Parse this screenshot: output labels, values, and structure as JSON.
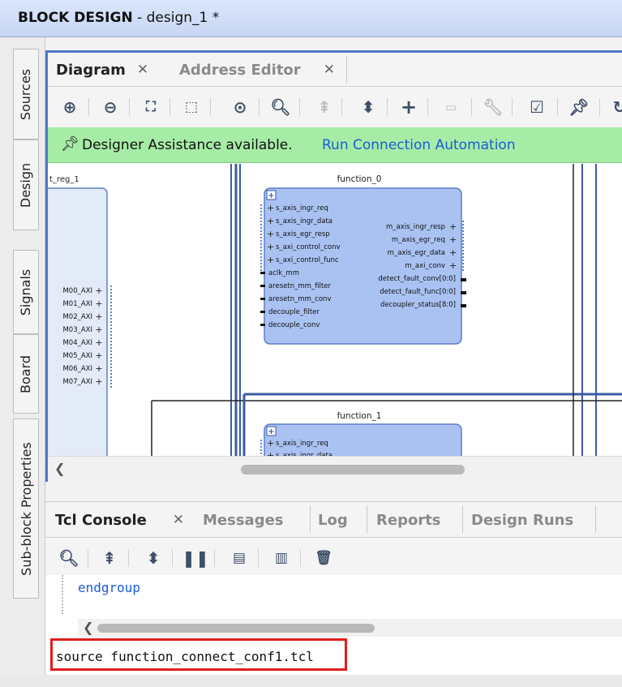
{
  "window": {
    "title_bold": "BLOCK DESIGN",
    "title_rest": " - design_1 *"
  },
  "left_tabs": [
    "Sources",
    "Design",
    "Signals",
    "Board",
    "Sub-block Properties"
  ],
  "diagram_panel": {
    "tabs": [
      {
        "label": "Diagram",
        "active": true
      },
      {
        "label": "Address Editor",
        "active": false
      }
    ],
    "toolbar_icons": [
      "zoom-in-icon",
      "zoom-out-icon",
      "zoom-fit-icon",
      "zoom-area-icon",
      "center-icon",
      "search-icon",
      "collapse-all-icon",
      "expand-all-icon",
      "add-ip-icon",
      "add-port-icon",
      "wrench-icon",
      "validate-icon",
      "pin-icon",
      "refresh-icon"
    ],
    "assistance": {
      "message": "Designer Assistance available.",
      "link": "Run Connection Automation"
    }
  },
  "diagram": {
    "left_block": {
      "title": "t_reg_1",
      "ports": [
        "M00_AXI",
        "M01_AXI",
        "M02_AXI",
        "M03_AXI",
        "M04_AXI",
        "M05_AXI",
        "M06_AXI",
        "M07_AXI"
      ]
    },
    "function_0": {
      "title": "function_0",
      "left_ports": [
        "s_axis_ingr_req",
        "s_axis_ingr_data",
        "s_axis_egr_resp",
        "s_axi_control_conv",
        "s_axi_control_func",
        "aclk_mm",
        "aresetn_mm_filter",
        "aresetn_mm_conv",
        "decouple_filter",
        "decouple_conv"
      ],
      "right_ports": [
        "m_axis_ingr_resp",
        "m_axis_egr_req",
        "m_axis_egr_data",
        "m_axi_conv",
        "detect_fault_conv[0:0]",
        "detect_fault_func[0:0]",
        "decoupler_status[8:0]"
      ]
    },
    "function_1": {
      "title": "function_1",
      "left_ports": [
        "s_axis_ingr_req",
        "s_axis_ingr_data"
      ]
    }
  },
  "tcl_panel": {
    "tabs": [
      {
        "label": "Tcl Console",
        "active": true
      },
      {
        "label": "Messages",
        "active": false
      },
      {
        "label": "Log",
        "active": false
      },
      {
        "label": "Reports",
        "active": false
      },
      {
        "label": "Design Runs",
        "active": false
      }
    ],
    "toolbar_icons": [
      "search-icon",
      "collapse-all-icon",
      "expand-all-icon",
      "pause-icon",
      "copy-icon",
      "columns-icon",
      "delete-icon"
    ],
    "log_line": "endgroup",
    "input_value": "source function_connect_conf1.tcl"
  },
  "colors": {
    "accent_border": "#4f78c7",
    "assist_bg": "#a6eca6",
    "link": "#1c5bd6",
    "block_fill": "#a9c2f2",
    "highlight_box": "#e01e1e"
  }
}
